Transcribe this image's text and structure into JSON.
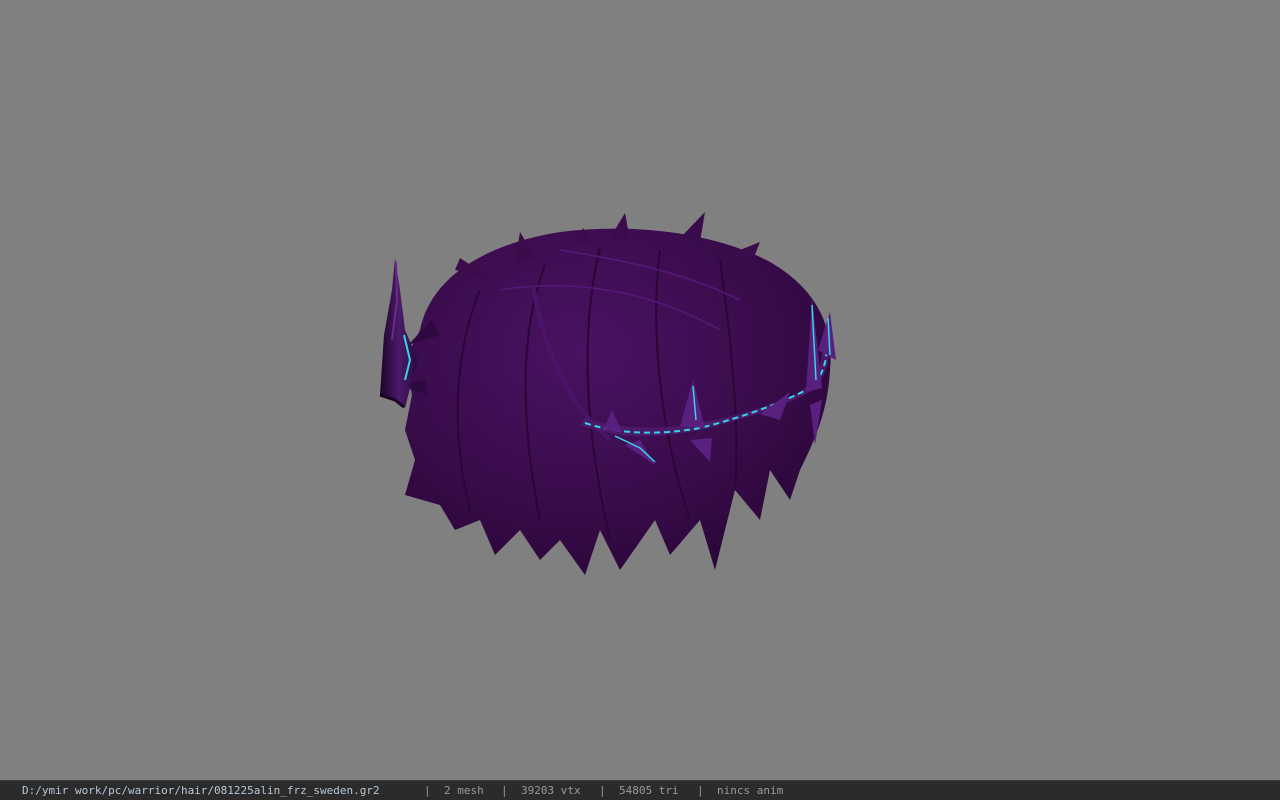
{
  "viewer": {
    "background_color": "#808080",
    "model": {
      "hair_color": "#3c0d4e",
      "accent_color": "#33d6e6",
      "icon": "hair-model"
    }
  },
  "statusbar": {
    "file_path": "D:/ymir work/pc/warrior/hair/081225alin_frz_sweden.gr2",
    "separator": "|",
    "mesh": "2 mesh",
    "vertices": "39203 vtx",
    "triangles": "54805 tri",
    "animation": "nincs anim"
  }
}
